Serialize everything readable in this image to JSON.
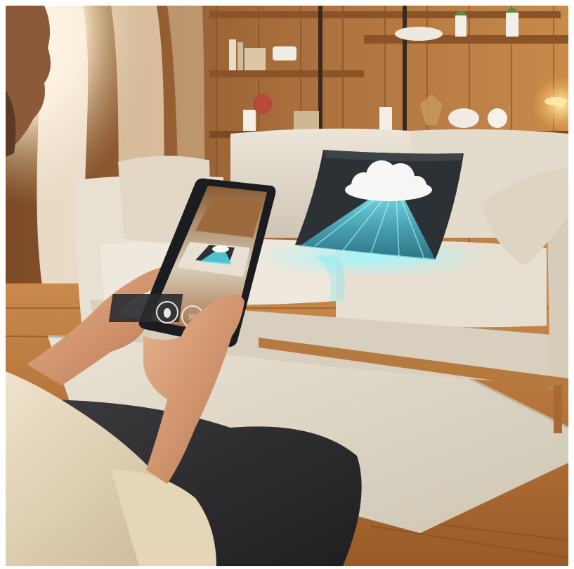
{
  "scene": {
    "phone_ui": {
      "left_control_icon": "bug-icon",
      "right_control_label": "3D"
    },
    "colors": {
      "wood_floor": "#b8733a",
      "sofa_fabric": "#e6ded0",
      "rug": "#e2dccd",
      "ar_hologram": "#47d8e8",
      "pillow": "#2b3134",
      "window_light": "#fff3dc",
      "wall_wood": "#b57a42"
    }
  }
}
